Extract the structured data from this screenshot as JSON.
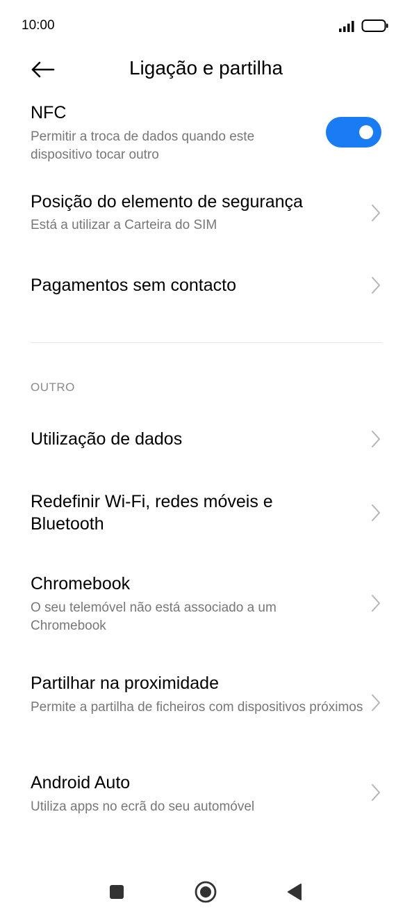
{
  "status_bar": {
    "time": "10:00",
    "icons": [
      "signal-icon",
      "battery-icon"
    ]
  },
  "header": {
    "title": "Ligação e partilha",
    "back_icon": "arrow-left-icon"
  },
  "nfc": {
    "title": "NFC",
    "subtitle": "Permitir a troca de dados quando este dispositivo tocar outro",
    "enabled": true
  },
  "items_top": [
    {
      "title": "Posição do elemento de segurança",
      "subtitle": "Está a utilizar a Carteira do SIM"
    },
    {
      "title": "Pagamentos sem contacto",
      "subtitle": ""
    }
  ],
  "section": {
    "label": "OUTRO"
  },
  "items_other": [
    {
      "title": "Utilização de dados",
      "subtitle": ""
    },
    {
      "title": "Redefinir Wi-Fi, redes móveis e Bluetooth",
      "subtitle": ""
    },
    {
      "title": "Chromebook",
      "subtitle": "O seu telemóvel não está associado a um Chromebook"
    },
    {
      "title": "Partilhar na proximidade",
      "subtitle": "Permite a partilha de ficheiros com dispositivos próximos"
    },
    {
      "title": "Android Auto",
      "subtitle": "Utiliza apps no ecrã do seu automóvel"
    }
  ],
  "colors": {
    "accent": "#1a7cf2",
    "subtitle": "#777777",
    "chevron": "#b5b5b5"
  },
  "nav_bar": {
    "icons": [
      "square-icon",
      "home-circle-icon",
      "back-triangle-icon"
    ]
  }
}
